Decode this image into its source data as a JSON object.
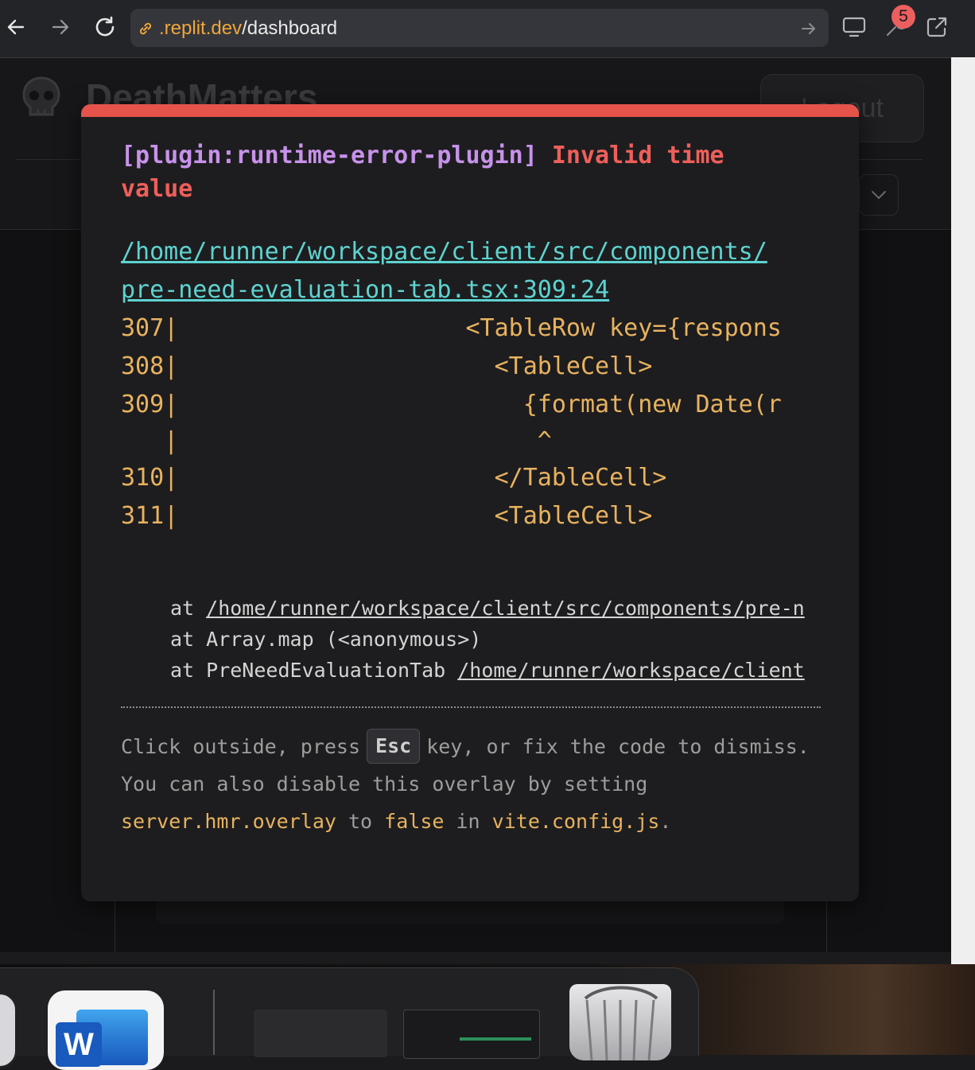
{
  "browser": {
    "url_host": ".replit.dev",
    "url_path": "/dashboard",
    "notification_count": "5"
  },
  "app": {
    "title": "DeathMatters",
    "logout_label": "Logout"
  },
  "overlay": {
    "plugin": "[plugin:runtime-error-plugin]",
    "message": "Invalid time value",
    "file_line1": "/home/runner/workspace/client/src/components/",
    "file_line2": "pre-need-evaluation-tab.tsx:309:24",
    "code_frame": [
      "307|                    <TableRow key={respons",
      "308|                      <TableCell>",
      "309|                        {format(new Date(r",
      "   |                         ^",
      "310|                      </TableCell>",
      "311|                      <TableCell>"
    ],
    "stack": [
      {
        "prefix": "at ",
        "link": "/home/runner/workspace/client/src/components/pre-n",
        "suffix": ""
      },
      {
        "prefix": "at Array.map (<anonymous>)",
        "link": "",
        "suffix": ""
      },
      {
        "prefix": "at PreNeedEvaluationTab ",
        "link": "/home/runner/workspace/client",
        "suffix": ""
      }
    ],
    "tip_part1": "Click outside, press",
    "tip_key": "Esc",
    "tip_part2": "key, or fix the code to dismiss.",
    "tip2_part1": "You can also disable this overlay by setting",
    "tip2_code1": "server.hmr.overlay",
    "tip2_to": "to",
    "tip2_code2": "false",
    "tip2_in": "in",
    "tip2_code3": "vite.config.js",
    "tip2_end": "."
  },
  "dock": {
    "word_letter": "W"
  }
}
